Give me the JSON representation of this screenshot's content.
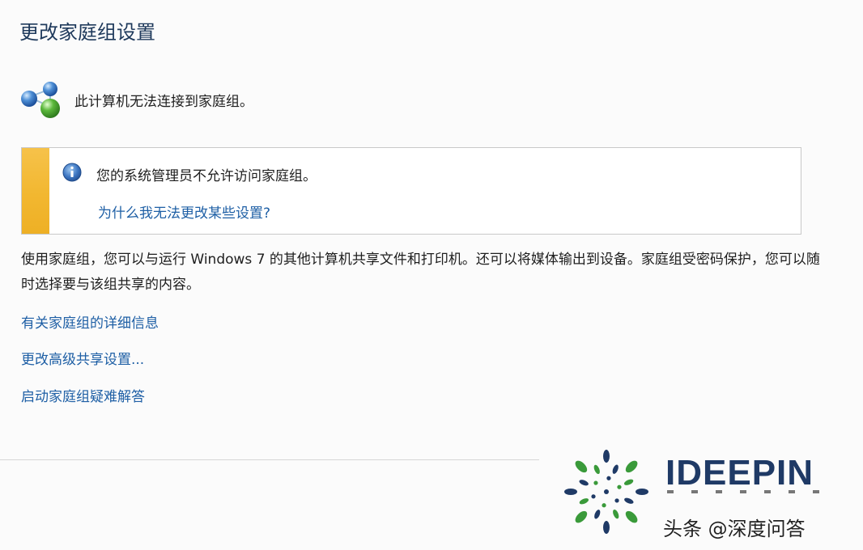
{
  "page": {
    "title": "更改家庭组设置",
    "status_text": "此计算机无法连接到家庭组。"
  },
  "info_box": {
    "message": "您的系统管理员不允许访问家庭组。",
    "link": "为什么我无法更改某些设置?"
  },
  "description": "使用家庭组，您可以与运行 Windows 7 的其他计算机共享文件和打印机。还可以将媒体输出到设备。家庭组受密码保护，您可以随时选择要与该组共享的内容。",
  "links": [
    "有关家庭组的详细信息",
    "更改高级共享设置...",
    "启动家庭组疑难解答"
  ],
  "watermark": {
    "brand": "IDEEPIN",
    "text": "头条 @深度问答"
  },
  "colors": {
    "link": "#1e5fa5",
    "title": "#1e395b",
    "warning_stripe": "#f2b730",
    "brand": "#1f3a66"
  },
  "icons": {
    "status": "homegroup-icon",
    "info": "info-icon",
    "brand": "spiral-logo-icon"
  }
}
